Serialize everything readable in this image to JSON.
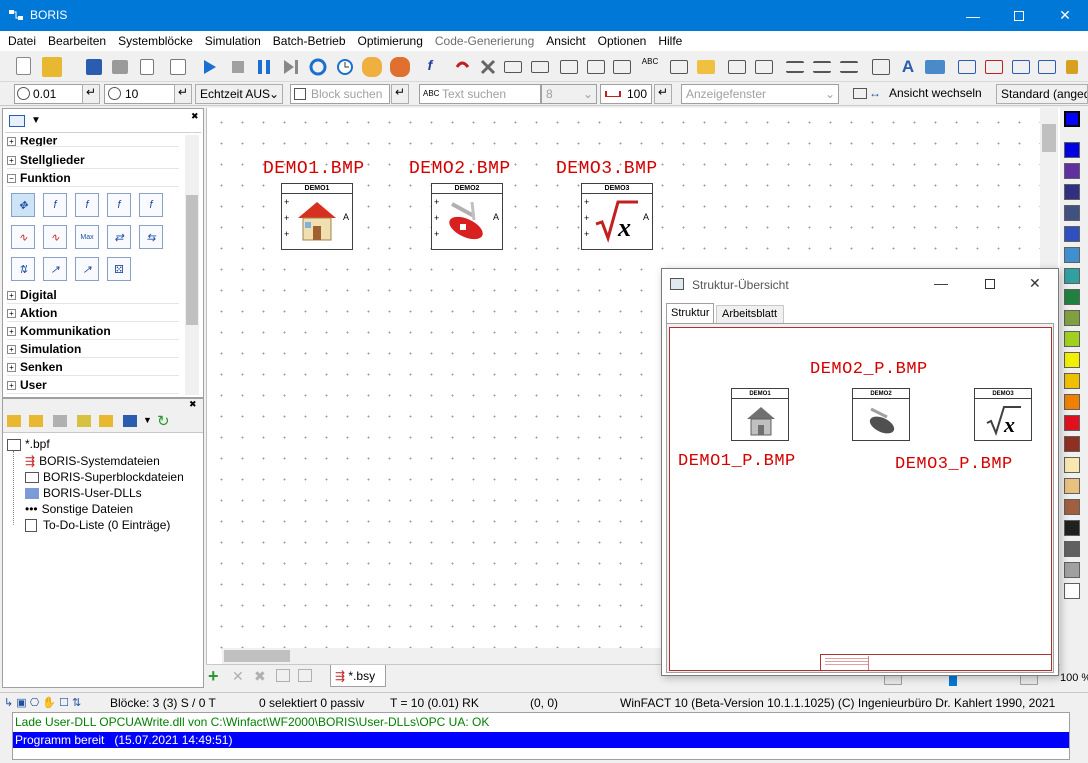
{
  "window": {
    "title": "BORIS"
  },
  "menu": [
    "Datei",
    "Bearbeiten",
    "Systemblöcke",
    "Simulation",
    "Batch-Betrieb",
    "Optimierung",
    "Code-Generierung",
    "Ansicht",
    "Optionen",
    "Hilfe"
  ],
  "toolbar2": {
    "step": "0.01",
    "end": "10",
    "realtime": "Echtzeit AUS",
    "block_search_placeholder": "Block suchen",
    "text_search_placeholder": "Text suchen",
    "text_search_count": "8",
    "zoom": "100",
    "display_window_placeholder": "Anzeigefenster",
    "switch_view": "Ansicht wechseln",
    "standard": "Standard (angedo"
  },
  "library": {
    "categories_top": [
      "Regler",
      "Stellglieder",
      "Funktion"
    ],
    "categories_bottom": [
      "Digital",
      "Aktion",
      "Kommunikation",
      "Simulation",
      "Senken",
      "User"
    ]
  },
  "project": {
    "root": "*.bpf",
    "items": [
      "BORIS-Systemdateien",
      "BORIS-Superblockdateien",
      "BORIS-User-DLLs",
      "Sonstige Dateien",
      "To-Do-Liste (0 Einträge)"
    ]
  },
  "workspace": {
    "blocks": [
      {
        "label": "DEMO1.BMP",
        "name": "DEMO1"
      },
      {
        "label": "DEMO2.BMP",
        "name": "DEMO2"
      },
      {
        "label": "DEMO3.BMP",
        "name": "DEMO3"
      }
    ],
    "output_letter": "A",
    "tab": "*.bsy"
  },
  "structure": {
    "title": "Struktur-Übersicht",
    "tabs": [
      "Struktur",
      "Arbeitsblatt"
    ],
    "labels": {
      "p1": "DEMO1_P.BMP",
      "p2": "DEMO2_P.BMP",
      "p3": "DEMO3_P.BMP"
    },
    "blocks": [
      "DEMO1",
      "DEMO2",
      "DEMO3"
    ]
  },
  "zoom_percent": "100 %",
  "status": {
    "blocks": "Blöcke: 3 (3) S / 0 T",
    "selected": "0 selektiert  0 passiv",
    "time": "T = 10  (0.01)  RK",
    "coords": "(0, 0)",
    "version": "WinFACT 10 (Beta-Version 10.1.1.1025)  (C) Ingenieurbüro Dr. Kahlert 1990, 2021"
  },
  "log": {
    "line1": "Lade User-DLL OPCUAWrite.dll von C:\\Winfact\\WF2000\\BORIS\\User-DLLs\\OPC UA: OK",
    "line2": "Programm bereit   (15.07.2021 14:49:51)"
  },
  "colors": {
    "accent": "#0078d7",
    "label_red": "#d40000",
    "log_green": "#008000",
    "log_highlight": "#0000ff"
  }
}
